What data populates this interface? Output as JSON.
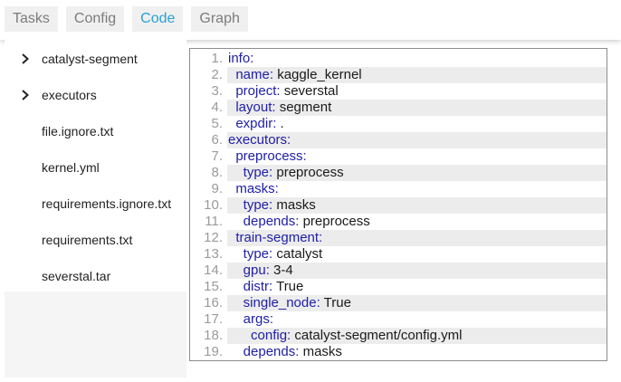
{
  "tabs": [
    {
      "label": "Tasks",
      "active": false
    },
    {
      "label": "Config",
      "active": false
    },
    {
      "label": "Code",
      "active": true
    },
    {
      "label": "Graph",
      "active": false
    }
  ],
  "sidebar": {
    "items": [
      {
        "label": "catalyst-segment",
        "icon": "chevron-right-icon",
        "expandable": true
      },
      {
        "label": "executors",
        "icon": "chevron-right-icon",
        "expandable": true
      },
      {
        "label": "file.ignore.txt",
        "expandable": false
      },
      {
        "label": "kernel.yml",
        "expandable": false
      },
      {
        "label": "requirements.ignore.txt",
        "expandable": false
      },
      {
        "label": "requirements.txt",
        "expandable": false
      },
      {
        "label": "severstal.tar",
        "expandable": false
      }
    ]
  },
  "code": {
    "lines": [
      {
        "num": "1.",
        "indent": "",
        "key": "info:",
        "value": ""
      },
      {
        "num": "2.",
        "indent": "  ",
        "key": "name:",
        "value": " kaggle_kernel"
      },
      {
        "num": "3.",
        "indent": "  ",
        "key": "project:",
        "value": " severstal"
      },
      {
        "num": "4.",
        "indent": "  ",
        "key": "layout:",
        "value": " segment"
      },
      {
        "num": "5.",
        "indent": "  ",
        "key": "expdir:",
        "value": " ."
      },
      {
        "num": "6.",
        "indent": "",
        "key": "executors:",
        "value": ""
      },
      {
        "num": "7.",
        "indent": "  ",
        "key": "preprocess:",
        "value": ""
      },
      {
        "num": "8.",
        "indent": "    ",
        "key": "type:",
        "value": " preprocess"
      },
      {
        "num": "9.",
        "indent": "  ",
        "key": "masks:",
        "value": ""
      },
      {
        "num": "10.",
        "indent": "    ",
        "key": "type:",
        "value": " masks"
      },
      {
        "num": "11.",
        "indent": "    ",
        "key": "depends:",
        "value": " preprocess"
      },
      {
        "num": "12.",
        "indent": "  ",
        "key": "train-segment:",
        "value": ""
      },
      {
        "num": "13.",
        "indent": "    ",
        "key": "type:",
        "value": " catalyst"
      },
      {
        "num": "14.",
        "indent": "    ",
        "key": "gpu:",
        "value": " 3-4"
      },
      {
        "num": "15.",
        "indent": "    ",
        "key": "distr:",
        "value": " True"
      },
      {
        "num": "16.",
        "indent": "    ",
        "key": "single_node:",
        "value": " True"
      },
      {
        "num": "17.",
        "indent": "    ",
        "key": "args:",
        "value": ""
      },
      {
        "num": "18.",
        "indent": "      ",
        "key": "config:",
        "value": " catalyst-segment/config.yml"
      },
      {
        "num": "19.",
        "indent": "    ",
        "key": "depends:",
        "value": " masks"
      }
    ]
  },
  "colors": {
    "accent": "#2a9fd8",
    "key": "#2020a8",
    "line_highlight": "#ececec"
  }
}
